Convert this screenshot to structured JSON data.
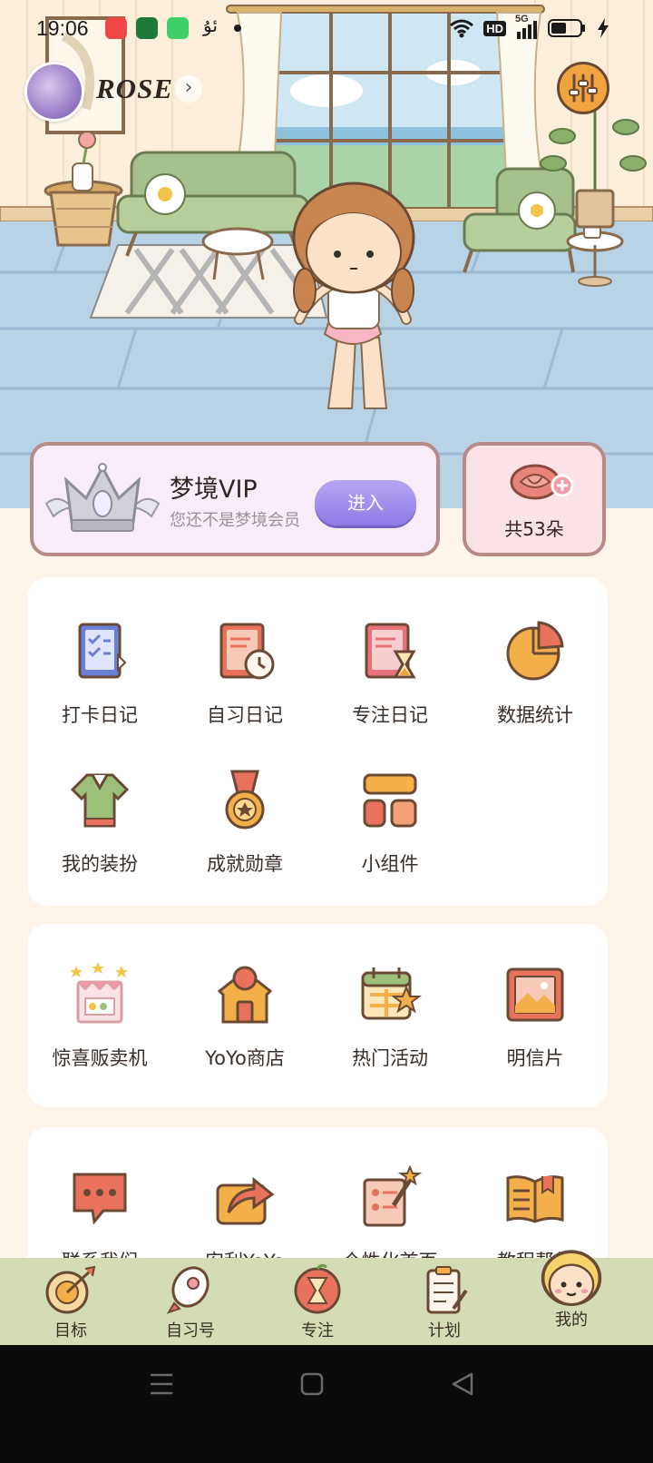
{
  "status_bar": {
    "time": "19:06",
    "extra_glyph": "ئۇ",
    "network": "5G",
    "hd": "HD"
  },
  "profile": {
    "username": "ROSE"
  },
  "vip": {
    "title": "梦境VIP",
    "subtitle": "您还不是梦境会员",
    "enter_label": "进入"
  },
  "flowers": {
    "count_label": "共53朵"
  },
  "section1": {
    "items": [
      {
        "label": "打卡日记",
        "icon": "checklist-book-icon"
      },
      {
        "label": "自习日记",
        "icon": "clock-book-icon"
      },
      {
        "label": "专注日记",
        "icon": "hourglass-book-icon"
      },
      {
        "label": "数据统计",
        "icon": "pie-chart-icon"
      },
      {
        "label": "我的装扮",
        "icon": "outfit-icon"
      },
      {
        "label": "成就勋章",
        "icon": "medal-icon"
      },
      {
        "label": "小组件",
        "icon": "widget-icon"
      }
    ]
  },
  "section2": {
    "items": [
      {
        "label": "惊喜贩卖机",
        "icon": "vending-machine-icon"
      },
      {
        "label": "YoYo商店",
        "icon": "shop-icon"
      },
      {
        "label": "热门活动",
        "icon": "calendar-star-icon"
      },
      {
        "label": "明信片",
        "icon": "postcard-icon"
      }
    ]
  },
  "section3": {
    "items": [
      {
        "label": "联系我们",
        "icon": "chat-icon"
      },
      {
        "label": "安利YoYo",
        "icon": "share-icon"
      },
      {
        "label": "个性化首页",
        "icon": "customize-icon"
      },
      {
        "label": "教程帮组",
        "icon": "guide-book-icon"
      }
    ]
  },
  "tabs": [
    {
      "label": "目标",
      "icon": "target-icon"
    },
    {
      "label": "自习号",
      "icon": "rocket-icon"
    },
    {
      "label": "专注",
      "icon": "focus-icon"
    },
    {
      "label": "计划",
      "icon": "clipboard-icon"
    },
    {
      "label": "我的",
      "icon": "profile-face-icon"
    }
  ],
  "colors": {
    "panel_bg": "#ffffff",
    "page_bg": "#fdf5ea",
    "tabbar_bg": "#d3dcb5",
    "vip_button": "#9c88ea"
  }
}
